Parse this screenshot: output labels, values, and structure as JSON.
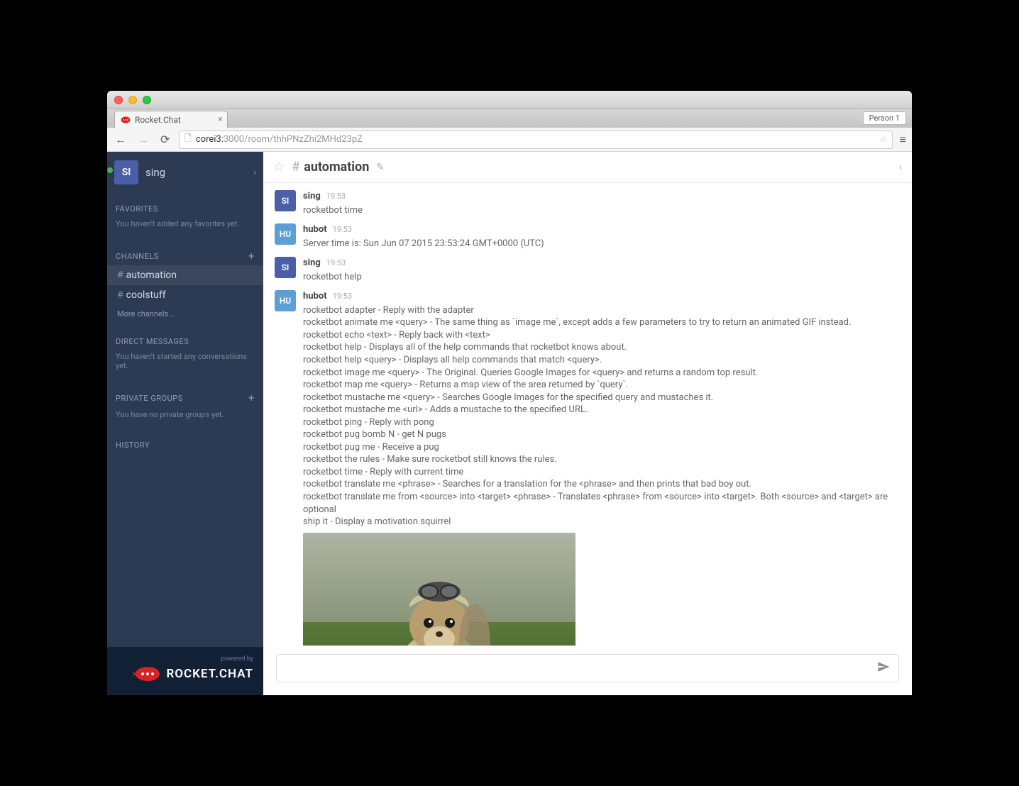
{
  "browser": {
    "profile_label": "Person 1",
    "tab_title": "Rocket.Chat",
    "url_host": "corei3:",
    "url_path": "3000/room/thhPNzZhi2MHd23pZ"
  },
  "sidebar": {
    "user": {
      "avatar_initials": "SI",
      "name": "sing"
    },
    "favorites": {
      "heading": "FAVORITES",
      "empty": "You haven't added any favorites yet."
    },
    "channels": {
      "heading": "CHANNELS",
      "items": [
        {
          "name": "automation",
          "active": true
        },
        {
          "name": "coolstuff",
          "active": false
        }
      ],
      "more": "More channels .."
    },
    "dms": {
      "heading": "DIRECT MESSAGES",
      "empty": "You haven't started any conversations yet."
    },
    "groups": {
      "heading": "PRIVATE GROUPS",
      "empty": "You have no private groups yet."
    },
    "history": {
      "heading": "HISTORY"
    },
    "footer": {
      "powered_by": "powered by",
      "brand": "ROCKET.CHAT"
    }
  },
  "room": {
    "name": "automation"
  },
  "messages": [
    {
      "avatar": "SI",
      "avatar_class": "av-si",
      "user": "sing",
      "time": "19:53",
      "text": "rocketbot time"
    },
    {
      "avatar": "HU",
      "avatar_class": "av-hu",
      "user": "hubot",
      "time": "19:53",
      "text": "Server time is: Sun Jun 07 2015 23:53:24 GMT+0000 (UTC)"
    },
    {
      "avatar": "SI",
      "avatar_class": "av-si",
      "user": "sing",
      "time": "19:53",
      "text": "rocketbot help"
    },
    {
      "avatar": "HU",
      "avatar_class": "av-hu",
      "user": "hubot",
      "time": "19:53",
      "text": "rocketbot adapter - Reply with the adapter\nrocketbot animate me <query> - The same thing as `image me`, except adds a few parameters to try to return an animated GIF instead.\nrocketbot echo <text> - Reply back with <text>\nrocketbot help - Displays all of the help commands that rocketbot knows about.\nrocketbot help <query> - Displays all help commands that match <query>.\nrocketbot image me <query> - The Original. Queries Google Images for <query> and returns a random top result.\nrocketbot map me <query> - Returns a map view of the area returned by `query`.\nrocketbot mustache me <query> - Searches Google Images for the specified query and mustaches it.\nrocketbot mustache me <url> - Adds a mustache to the specified URL.\nrocketbot ping - Reply with pong\nrocketbot pug bomb N - get N pugs\nrocketbot pug me - Receive a pug\nrocketbot the rules - Make sure rocketbot still knows the rules.\nrocketbot time - Reply with current time\nrocketbot translate me <phrase> - Searches for a translation for the <phrase> and then prints that bad boy out.\nrocketbot translate me from <source> into <target> <phrase> - Translates <phrase> from <source> into <target>. Both <source> and <target> are optional\nship it - Display a motivation squirrel",
      "has_image": true
    }
  ],
  "composer": {
    "placeholder": ""
  }
}
